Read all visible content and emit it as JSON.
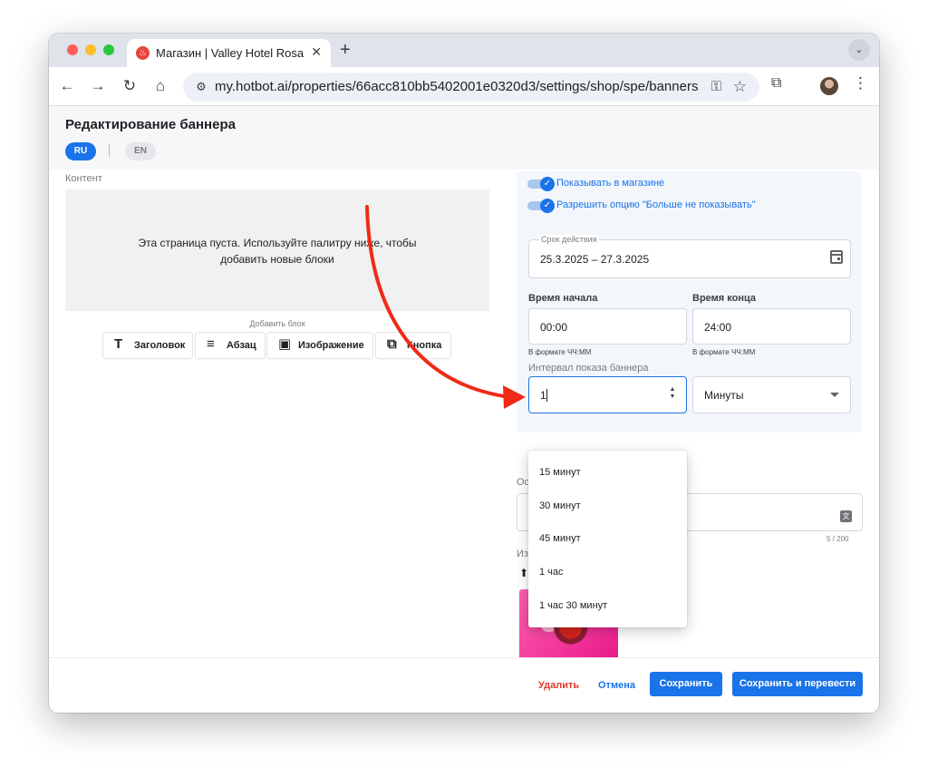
{
  "browser": {
    "tab_title": "Магазин | Valley Hotel Rosa Khutor",
    "tab_close_glyph": "✕",
    "new_tab_glyph": "+",
    "url": "my.hotbot.ai/properties/66acc810bb5402001e0320d3/settings/shop/spe/banners"
  },
  "page": {
    "title": "Редактирование баннера",
    "languages": [
      "RU",
      "EN"
    ]
  },
  "content": {
    "section_label": "Контент",
    "empty_line1": "Эта страница пуста. Используйте палитру ниже, чтобы",
    "empty_line2": "добавить новые блоки",
    "add_block_label": "Добавить блок",
    "block_buttons": [
      "Заголовок",
      "Абзац",
      "Изображение",
      "Кнопка"
    ]
  },
  "settings": {
    "show_in_shop": "Показывать в магазине",
    "allow_dont_show": "Разрешить опцию \"Больше не показывать\"",
    "validity_label": "Срок действия",
    "validity_value": "25.3.2025 – 27.3.2025",
    "start_time_label": "Время начала",
    "start_time_value": "00:00",
    "end_time_label": "Время конца",
    "end_time_value": "24:00",
    "time_format_hint": "В формате ЧЧ:ММ",
    "interval_label": "Интервал показа баннера",
    "interval_value": "1",
    "interval_unit": "Минуты",
    "interval_options": [
      "15 минут",
      "30 минут",
      "45 минут",
      "1 час",
      "1 час 30 минут"
    ]
  },
  "behind_dropdown": {
    "label_fragment_1": "Ос",
    "label_fragment_2": "Из",
    "counter": "5 / 200"
  },
  "footer": {
    "delete": "Удалить",
    "cancel": "Отмена",
    "save": "Сохранить",
    "save_translate": "Сохранить и перевести"
  },
  "colors": {
    "accent": "#1a73e8",
    "danger": "#e0382d",
    "annotation_arrow": "#f02a16"
  },
  "icons": {
    "back": "arrow-left",
    "forward": "arrow-right",
    "reload": "reload",
    "home": "home",
    "site_settings": "tune",
    "password_key": "key",
    "bookmark": "star",
    "extensions": "puzzle",
    "menu": "more-vert",
    "calendar": "calendar",
    "translate": "translate",
    "upload": "upload"
  }
}
